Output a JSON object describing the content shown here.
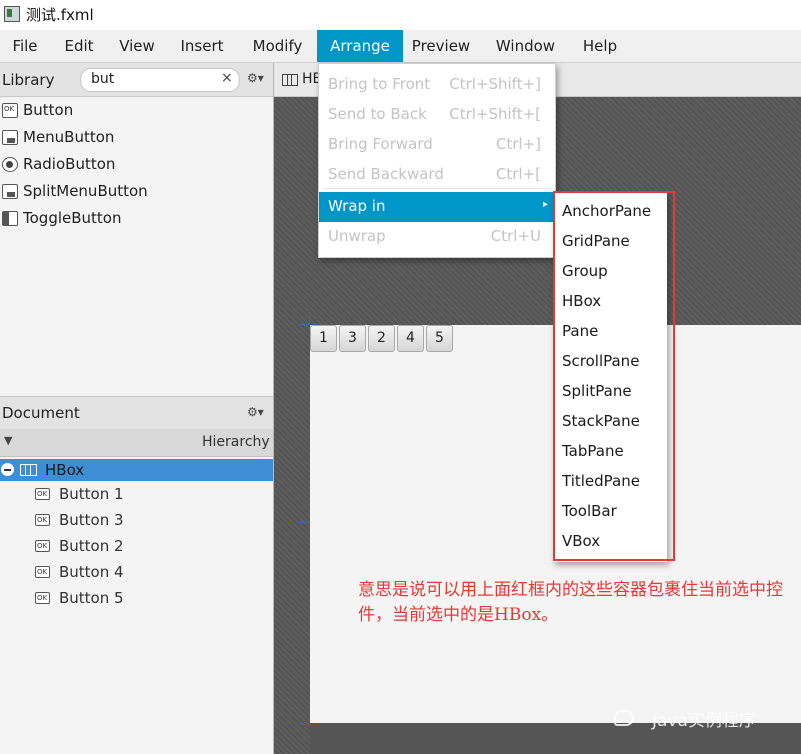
{
  "window": {
    "title": "测试.fxml"
  },
  "menubar": [
    {
      "label": "File",
      "active": false
    },
    {
      "label": "Edit",
      "active": false
    },
    {
      "label": "View",
      "active": false
    },
    {
      "label": "Insert",
      "active": false
    },
    {
      "label": "Modify",
      "active": false
    },
    {
      "label": "Arrange",
      "active": true
    },
    {
      "label": "Preview",
      "active": false
    },
    {
      "label": "Window",
      "active": false
    },
    {
      "label": "Help",
      "active": false
    }
  ],
  "library": {
    "title": "Library",
    "search_value": "but",
    "clear_icon": "×",
    "gear_icon": "⚙▾",
    "items": [
      {
        "label": "Button",
        "icon": "ok-button-icon"
      },
      {
        "label": "MenuButton",
        "icon": "menu-button-icon"
      },
      {
        "label": "RadioButton",
        "icon": "radio-icon"
      },
      {
        "label": "SplitMenuButton",
        "icon": "split-menu-button-icon"
      },
      {
        "label": "ToggleButton",
        "icon": "toggle-icon"
      }
    ]
  },
  "document": {
    "title": "Document",
    "gear_icon": "⚙▾",
    "hierarchy_label": "Hierarchy",
    "root": {
      "label": "HBox",
      "selected": true
    },
    "children": [
      {
        "label": "Button  1"
      },
      {
        "label": "Button  3"
      },
      {
        "label": "Button  2"
      },
      {
        "label": "Button  4"
      },
      {
        "label": "Button  5"
      }
    ]
  },
  "tab": {
    "label": "HB"
  },
  "stage_buttons": [
    "1",
    "3",
    "2",
    "4",
    "5"
  ],
  "arrange_menu": {
    "items": [
      {
        "label": "Bring to Front",
        "shortcut": "Ctrl+Shift+]",
        "enabled": false
      },
      {
        "label": "Send to Back",
        "shortcut": "Ctrl+Shift+[",
        "enabled": false
      },
      {
        "label": "Bring Forward",
        "shortcut": "Ctrl+]",
        "enabled": false
      },
      {
        "label": "Send Backward",
        "shortcut": "Ctrl+[",
        "enabled": false
      },
      {
        "label": "Wrap in",
        "shortcut": "",
        "enabled": true,
        "active": true,
        "submenu_arrow": "▸"
      },
      {
        "label": "Unwrap",
        "shortcut": "Ctrl+U",
        "enabled": false
      }
    ]
  },
  "wrap_submenu": [
    "AnchorPane",
    "GridPane",
    "Group",
    "HBox",
    "Pane",
    "ScrollPane",
    "SplitPane",
    "StackPane",
    "TabPane",
    "TitledPane",
    "ToolBar",
    "VBox"
  ],
  "annotation": "意思是说可以用上面红框内的这些容器包裹住当前选中控件，当前选中的是HBox。",
  "watermark": "Java实例程序",
  "colors": {
    "accent": "#0096c9",
    "selection": "#3d8ed4",
    "highlight_box": "#e5383b"
  }
}
